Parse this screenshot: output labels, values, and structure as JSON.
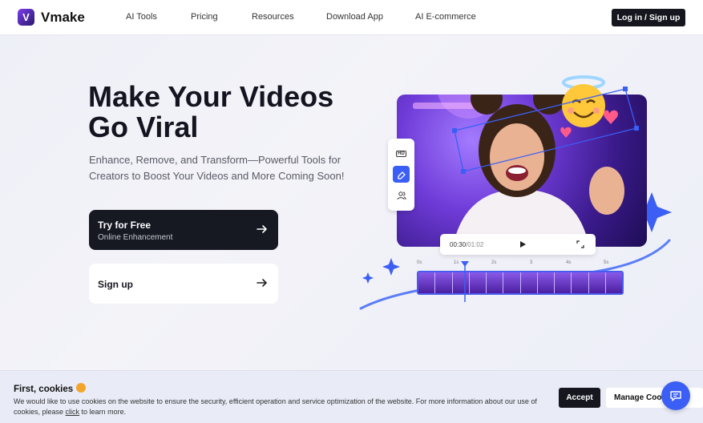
{
  "header": {
    "brand": "Vmake",
    "nav": [
      "AI Tools",
      "Pricing",
      "Resources",
      "Download App",
      "AI E-commerce"
    ],
    "login_label": "Log in / Sign up"
  },
  "hero": {
    "title": "Make Your Videos Go Viral",
    "subtitle": "Enhance, Remove, and Transform—Powerful Tools for Creators to Boost Your Videos and More Coming Soon!",
    "try_label": "Try for Free",
    "try_sub": "Online Enhancement",
    "signup_label": "Sign up"
  },
  "player": {
    "current": "00:30",
    "total": "/01:02",
    "tool_hd": "HD",
    "timeline_ticks": [
      "0s",
      "1s",
      "2s",
      "3",
      "4s",
      "5s"
    ]
  },
  "cookie": {
    "title": "First, cookies",
    "text_before": "We would like to use cookies on the website to ensure the security, efficient operation and service optimization of the website. For more information about our use of cookies, please ",
    "link": "click",
    "text_after": " to learn more.",
    "accept": "Accept",
    "manage": "Manage Cookies"
  },
  "colors": {
    "accent": "#3b5ff5",
    "dark": "#16161f"
  }
}
